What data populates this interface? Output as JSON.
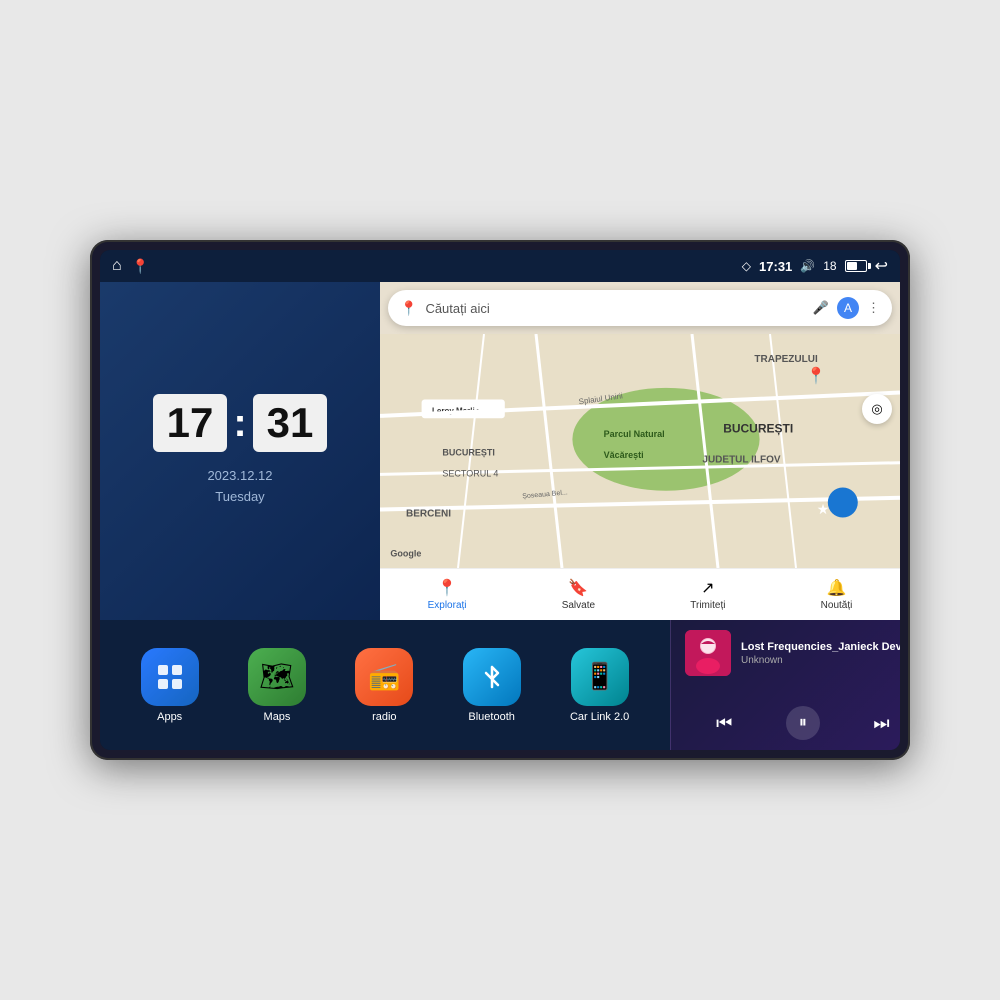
{
  "device": {
    "statusBar": {
      "time": "17:31",
      "batteryLevel": "18",
      "signalIcon": "◇",
      "volumeIcon": "🔊",
      "batteryIcon": "🔋",
      "homeIcon": "⌂",
      "mapPinIcon": "📍",
      "backIcon": "↩"
    },
    "clockWidget": {
      "hours": "17",
      "minutes": "31",
      "date": "2023.12.12",
      "dayOfWeek": "Tuesday"
    },
    "map": {
      "searchPlaceholder": "Căutați aici",
      "bottomNav": [
        {
          "label": "Explorați",
          "icon": "📍",
          "active": true
        },
        {
          "label": "Salvate",
          "icon": "🔖",
          "active": false
        },
        {
          "label": "Trimiteți",
          "icon": "🔄",
          "active": false
        },
        {
          "label": "Noutăți",
          "icon": "🔔",
          "active": false
        }
      ],
      "labels": [
        "TRAPEZULUI",
        "BUCUREȘTI",
        "JUDEȚUL ILFOV",
        "BERCENI",
        "BUCUREȘTI SECTORUL 4",
        "Parcul Natural Văcărești",
        "Leroy Merlin"
      ]
    },
    "appIcons": [
      {
        "id": "apps",
        "label": "Apps",
        "icon": "⊞",
        "colorClass": "icon-apps"
      },
      {
        "id": "maps",
        "label": "Maps",
        "icon": "🗺",
        "colorClass": "icon-maps"
      },
      {
        "id": "radio",
        "label": "radio",
        "icon": "📻",
        "colorClass": "icon-radio"
      },
      {
        "id": "bluetooth",
        "label": "Bluetooth",
        "icon": "⚡",
        "colorClass": "icon-bluetooth"
      },
      {
        "id": "carlink",
        "label": "Car Link 2.0",
        "icon": "📱",
        "colorClass": "icon-carlink"
      }
    ],
    "musicPlayer": {
      "title": "Lost Frequencies_Janieck Devy-...",
      "artist": "Unknown",
      "prevIcon": "⏮",
      "playIcon": "⏸",
      "nextIcon": "⏭"
    }
  }
}
